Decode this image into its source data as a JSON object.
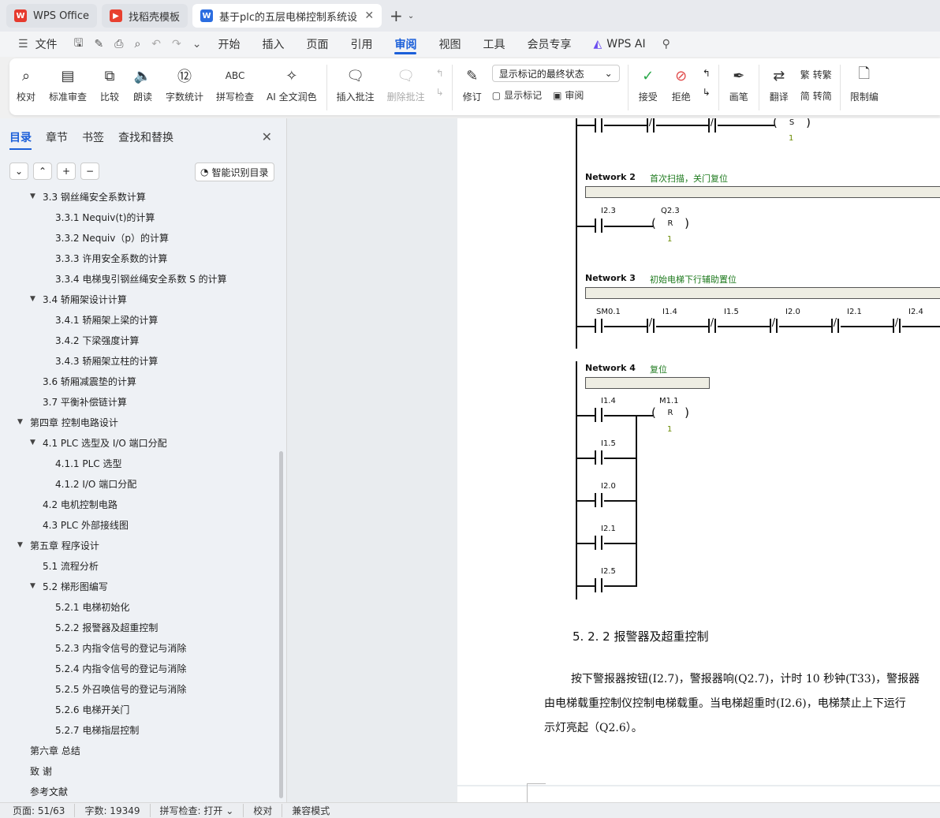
{
  "tabs": [
    {
      "label": "WPS Office",
      "icon": "wps-logo-icon"
    },
    {
      "label": "找稻壳模板",
      "icon": "docer-icon"
    },
    {
      "label": "基于plc的五层电梯控制系统设",
      "icon": "writer-icon"
    }
  ],
  "menu": {
    "file": "文件",
    "items": [
      "开始",
      "插入",
      "页面",
      "引用",
      "审阅",
      "视图",
      "工具",
      "会员专享"
    ],
    "ai": "WPS AI",
    "active": "审阅"
  },
  "ribbon": {
    "proofread": "校对",
    "standard_review": "标准审查",
    "compare": "比较",
    "read_aloud": "朗读",
    "word_count": "字数统计",
    "spell_check": "拼写检查",
    "ai_polish": "AI 全文润色",
    "insert_comment": "插入批注",
    "delete_comment": "删除批注",
    "revise": "修订",
    "markup_select": "显示标记的最终状态",
    "show_markup": "显示标记",
    "review": "审阅",
    "accept": "接受",
    "reject": "拒绝",
    "pen": "画笔",
    "translate": "翻译",
    "to_traditional": "转繁",
    "to_simplified": "转简",
    "restrict": "限制编"
  },
  "sidebar": {
    "tabs": [
      "目录",
      "章节",
      "书签",
      "查找和替换"
    ],
    "smart_btn": "智能识别目录",
    "toc": [
      {
        "label": "3.3   钢丝绳安全系数计算",
        "level": 1,
        "open": true
      },
      {
        "label": "3.3.1 Nequiv(t)的计算",
        "level": 2
      },
      {
        "label": "3.3.2 Nequiv（p）的计算",
        "level": 2
      },
      {
        "label": "3.3.3 许用安全系数的计算",
        "level": 2
      },
      {
        "label": "3.3.4 电梯曳引钢丝绳安全系数 S 的计算",
        "level": 2
      },
      {
        "label": "3.4   轿厢架设计计算",
        "level": 1,
        "open": true
      },
      {
        "label": "3.4.1 轿厢架上梁的计算",
        "level": 2
      },
      {
        "label": "3.4.2 下梁强度计算",
        "level": 2
      },
      {
        "label": "3.4.3 轿厢架立柱的计算",
        "level": 2
      },
      {
        "label": "3.6 轿厢减震垫的计算",
        "level": 1
      },
      {
        "label": "3.7 平衡补偿链计算",
        "level": 1
      },
      {
        "label": "第四章   控制电路设计",
        "level": 0,
        "open": true
      },
      {
        "label": "4.1 PLC 选型及 I/O 端口分配",
        "level": 1,
        "open": true
      },
      {
        "label": "4.1.1 PLC 选型",
        "level": 2
      },
      {
        "label": "4.1.2 I/O 端口分配",
        "level": 2
      },
      {
        "label": "4.2  电机控制电路",
        "level": 1
      },
      {
        "label": "4.3 PLC 外部接线图",
        "level": 1
      },
      {
        "label": "第五章   程序设计",
        "level": 0,
        "open": true
      },
      {
        "label": "5.1  流程分析",
        "level": 1
      },
      {
        "label": "5.2  梯形图编写",
        "level": 1,
        "open": true
      },
      {
        "label": "5.2.1  电梯初始化",
        "level": 2
      },
      {
        "label": "5.2.2 报警器及超重控制",
        "level": 2
      },
      {
        "label": "5.2.3  内指令信号的登记与消除",
        "level": 2
      },
      {
        "label": "5.2.4 内指令信号的登记与消除",
        "level": 2
      },
      {
        "label": "5.2.5  外召唤信号的登记与消除",
        "level": 2
      },
      {
        "label": "5.2.6 电梯开关门",
        "level": 2
      },
      {
        "label": "5.2.7 电梯指层控制",
        "level": 2
      },
      {
        "label": "第六章   总结",
        "level": 0
      },
      {
        "label": "致   谢",
        "level": 0
      },
      {
        "label": "参考文献",
        "level": 0
      }
    ]
  },
  "doc": {
    "net1": {
      "coil_op": "S",
      "coil_val": "1"
    },
    "net2": {
      "label": "Network 2",
      "comment": "首次扫描，关门复位",
      "c1": "I2.3",
      "coil": "Q2.3",
      "coil_op": "R",
      "coil_val": "1"
    },
    "net3": {
      "label": "Network 3",
      "comment": "初始电梯下行辅助置位",
      "c1": "SM0.1",
      "c2": "I1.4",
      "c3": "I1.5",
      "c4": "I2.0",
      "c5": "I2.1",
      "c6": "I2.4"
    },
    "net4": {
      "label": "Network 4",
      "comment": "复位",
      "c1": "I1.4",
      "c2": "I1.5",
      "c3": "I2.0",
      "c4": "I2.1",
      "c5": "I2.5",
      "coil": "M1.1",
      "coil_op": "R",
      "coil_val": "1"
    },
    "heading": "5. 2. 2 报警器及超重控制",
    "para": [
      "按下警报器按钮(I2.7)，警报器响(Q2.7)，计时 10 秒钟(T33)，警报器",
      "由电梯载重控制仪控制电梯载重。当电梯超重时(I2.6)，电梯禁止上下运行",
      "示灯亮起（Q2.6）。"
    ]
  },
  "status": {
    "page": "页面: 51/63",
    "words": "字数: 19349",
    "spell": "拼写检查: 打开",
    "proof": "校对",
    "compat": "兼容模式"
  }
}
